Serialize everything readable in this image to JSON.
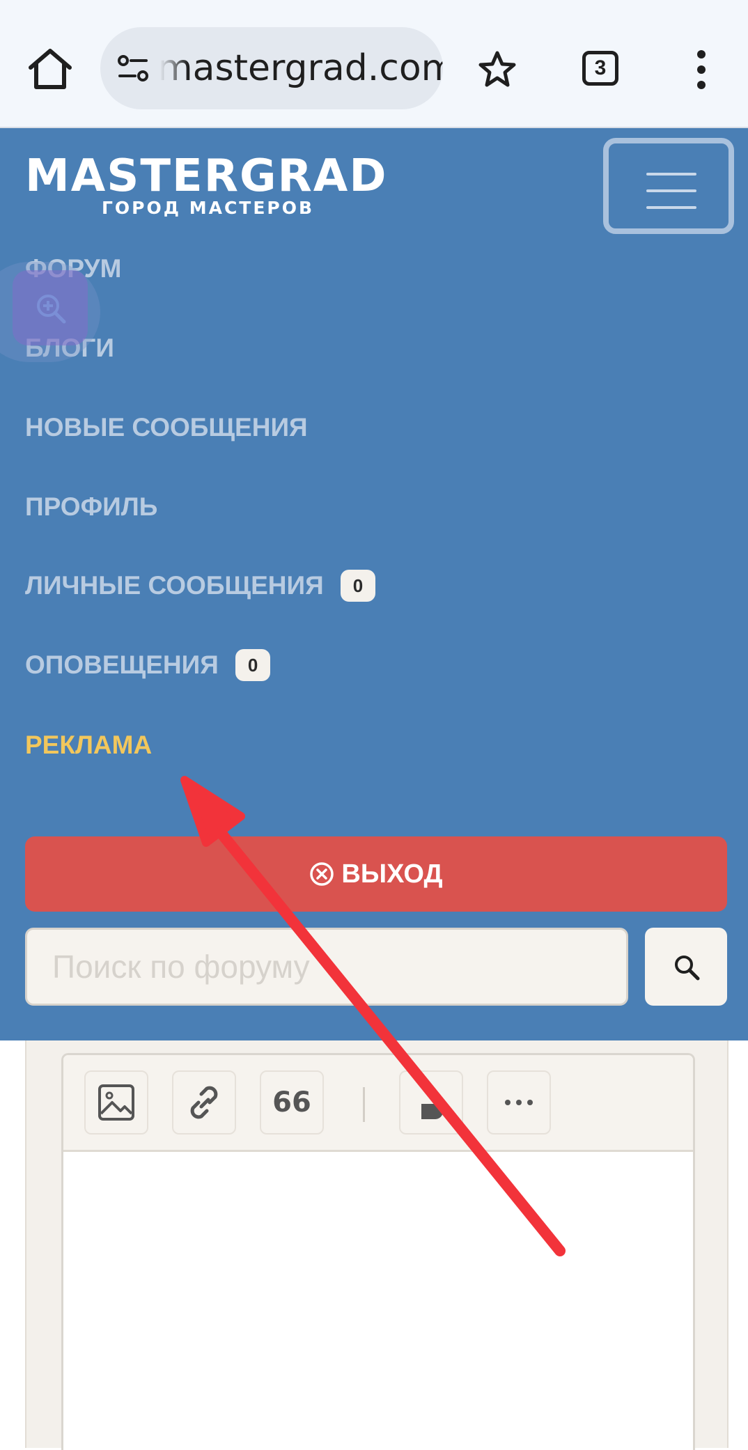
{
  "browser": {
    "url_text": "mastergrad.com",
    "tab_count": "3",
    "icons": [
      "home-icon",
      "site-settings-icon",
      "star-icon",
      "tabs-icon",
      "more-vert-icon"
    ]
  },
  "header": {
    "logo_main": "MASTERGRAD",
    "logo_sub": "ГОРОД МАСТЕРОВ"
  },
  "nav": {
    "forum": "ФОРУМ",
    "blogs": "БЛОГИ",
    "new_posts": "НОВЫЕ СООБЩЕНИЯ",
    "profile": "ПРОФИЛЬ",
    "messages": "ЛИЧНЫЕ СООБЩЕНИЯ",
    "messages_count": "0",
    "notifications": "ОПОВЕЩЕНИЯ",
    "notifications_count": "0",
    "ads": "РЕКЛАМА"
  },
  "logout_label": "ВЫХОД",
  "search": {
    "placeholder": "Поиск по форуму"
  },
  "editor": {
    "quote_label": "66",
    "tools": [
      "image-icon",
      "link-icon",
      "quote-icon",
      "bold-icon",
      "more-icon"
    ]
  },
  "colors": {
    "header_bg": "#4a7fb5",
    "nav_text": "#b8cbe1",
    "ads_text": "#f2c75c",
    "logout_bg": "#d9534f",
    "annotation_arrow": "#f2333a"
  }
}
